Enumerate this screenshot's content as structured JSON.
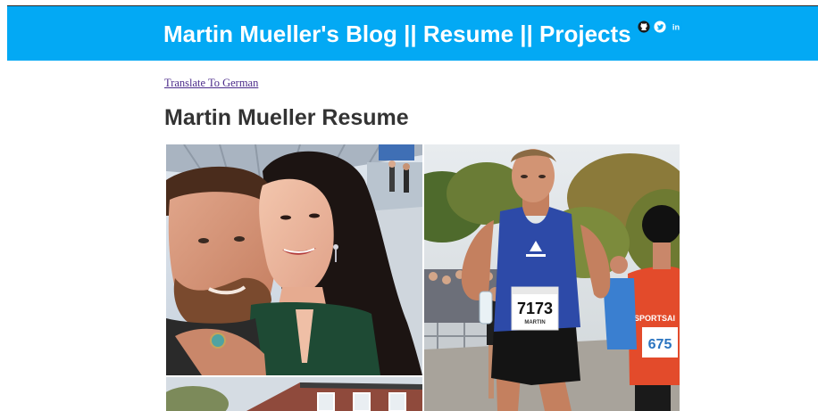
{
  "header": {
    "site_title": "Martin Mueller's Blog || Resume || Projects",
    "accent_color": "#03a9f4",
    "social_icons": [
      "github-icon",
      "twitter-icon",
      "linkedin-icon"
    ],
    "linkedin_text": "in"
  },
  "main": {
    "translate_link": "Translate To German",
    "heading": "Martin Mueller Resume"
  },
  "photos": {
    "couple": "couple-selfie-photo",
    "runner": "marathon-runner-photo",
    "house": "house-photo",
    "race_bib_number": "7173",
    "race_bib_name": "MARTIN",
    "race_bib_number_2": "675",
    "shirt_brand": "SPORTSAI"
  }
}
